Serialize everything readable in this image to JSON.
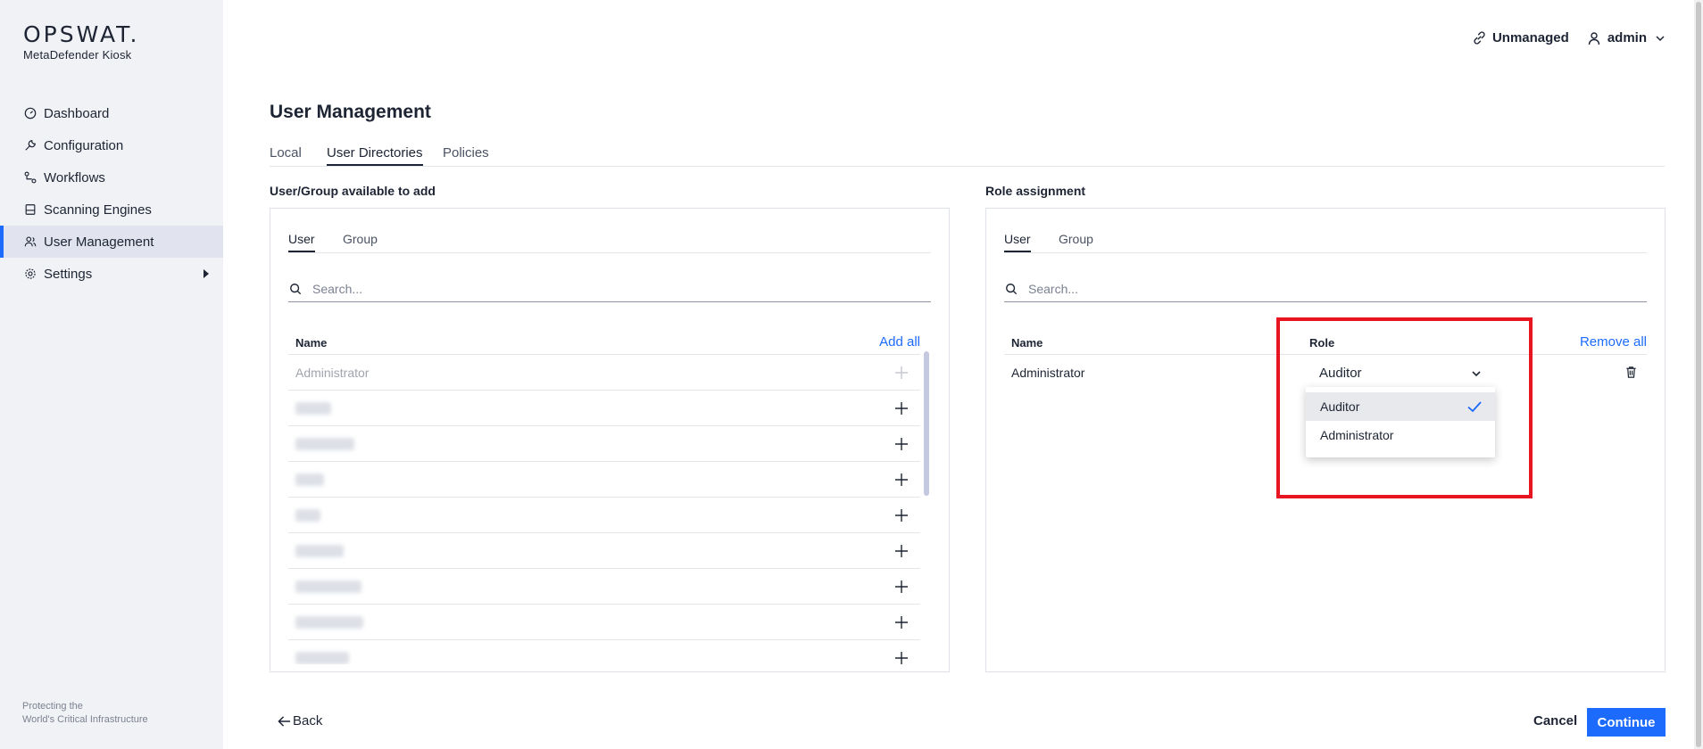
{
  "app": {
    "logo": "OPSWAT.",
    "product": "MetaDefender Kiosk",
    "tagline_line1": "Protecting the",
    "tagline_line2": "World's Critical Infrastructure"
  },
  "sidebar": {
    "items": [
      {
        "label": "Dashboard",
        "icon": "gauge-icon"
      },
      {
        "label": "Configuration",
        "icon": "wrench-icon"
      },
      {
        "label": "Workflows",
        "icon": "workflow-icon"
      },
      {
        "label": "Scanning Engines",
        "icon": "engine-icon"
      },
      {
        "label": "User Management",
        "icon": "users-icon",
        "active": true
      },
      {
        "label": "Settings",
        "icon": "gear-icon"
      }
    ]
  },
  "header": {
    "status": "Unmanaged",
    "user": "admin"
  },
  "page": {
    "title": "User Management",
    "tabs": [
      "Local",
      "User Directories",
      "Policies"
    ],
    "active_tab": "User Directories"
  },
  "left_panel": {
    "label": "User/Group available to add",
    "tabs": [
      "User",
      "Group"
    ],
    "search_placeholder": "Search...",
    "column_name": "Name",
    "action": "Add all",
    "rows": [
      {
        "name": "Administrator",
        "disabled": true
      }
    ]
  },
  "right_panel": {
    "label": "Role assignment",
    "tabs": [
      "User",
      "Group"
    ],
    "search_placeholder": "Search...",
    "column_name": "Name",
    "column_role": "Role",
    "action": "Remove all",
    "row": {
      "name": "Administrator",
      "role": "Auditor"
    },
    "role_options": [
      "Auditor",
      "Administrator"
    ],
    "selected_role": "Auditor"
  },
  "footer": {
    "back": "Back",
    "cancel": "Cancel",
    "continue": "Continue"
  },
  "colors": {
    "accent": "#1d6bfc",
    "highlight": "#e8141f",
    "sidebar_bg": "#f1f2f5"
  }
}
